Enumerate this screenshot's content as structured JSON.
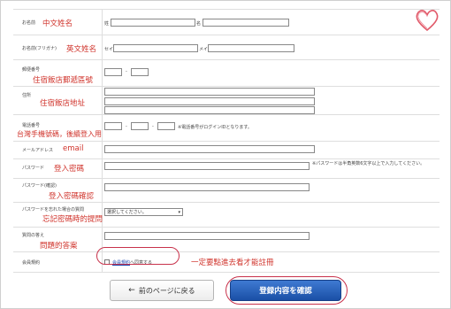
{
  "fields": {
    "name": {
      "label": "お名前",
      "note": "中文姓名",
      "sub1": "姓",
      "sub2": "名"
    },
    "kana": {
      "label": "お名前(フリガナ)",
      "note": "英文姓名",
      "sub1": "セイ",
      "sub2": "メイ"
    },
    "zip": {
      "label": "郵便番号",
      "note": "住宿飯店郵遞區號",
      "sep": "-"
    },
    "addr": {
      "label": "住所",
      "note": "住宿飯店地址"
    },
    "phone": {
      "label": "電話番号",
      "note": "台灣手機號碼，後續登入用",
      "sep1": "-",
      "sep2": "-",
      "hint": "※電話番号がログインIDとなります。"
    },
    "email": {
      "label": "メールアドレス",
      "note": "email"
    },
    "password": {
      "label": "パスワード",
      "note": "登入密碼",
      "hint": "※パスワードは半角英数6文字以上で入力してください。"
    },
    "password_confirm": {
      "label": "パスワード(確認)",
      "note": "登入密碼確認"
    },
    "secret_q": {
      "label": "パスワードを忘れた場合の質問",
      "note": "忘記密碼時的提問",
      "selected": "選択してください。"
    },
    "secret_a": {
      "label": "質問の答え",
      "note": "問題的答案"
    },
    "terms": {
      "label": "会員規約",
      "link": "会員規約",
      "suffix": "へ同意する",
      "note": "一定要點進去看才能註冊"
    }
  },
  "buttons": {
    "back": "前のページに戻る",
    "submit": "登録内容を確認"
  },
  "colors": {
    "annotation": "#d0342c",
    "submit_bg": "#2a5fb8"
  }
}
